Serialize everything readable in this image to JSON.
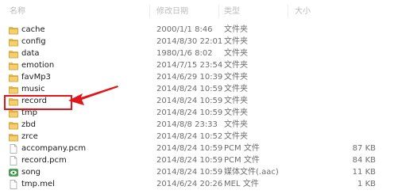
{
  "columns": {
    "name": "名称",
    "date": "修改日期",
    "type": "类型",
    "size": "大小"
  },
  "files": [
    {
      "name": "cache",
      "date": "2000/1/1 8:46",
      "type": "文件夹",
      "size": "",
      "icon": "folder-icon"
    },
    {
      "name": "config",
      "date": "2014/8/30 22:01",
      "type": "文件夹",
      "size": "",
      "icon": "folder-icon"
    },
    {
      "name": "data",
      "date": "1980/1/6 8:02",
      "type": "文件夹",
      "size": "",
      "icon": "folder-icon"
    },
    {
      "name": "emotion",
      "date": "2014/7/15 23:54",
      "type": "文件夹",
      "size": "",
      "icon": "folder-icon"
    },
    {
      "name": "favMp3",
      "date": "2014/6/29 10:39",
      "type": "文件夹",
      "size": "",
      "icon": "folder-icon"
    },
    {
      "name": "music",
      "date": "2014/8/24 10:59",
      "type": "文件夹",
      "size": "",
      "icon": "folder-icon"
    },
    {
      "name": "record",
      "date": "2014/8/24 10:59",
      "type": "文件夹",
      "size": "",
      "icon": "folder-icon"
    },
    {
      "name": "tmp",
      "date": "2014/8/24 10:59",
      "type": "文件夹",
      "size": "",
      "icon": "folder-icon"
    },
    {
      "name": "zbd",
      "date": "2014/8/8 23:33",
      "type": "文件夹",
      "size": "",
      "icon": "folder-icon"
    },
    {
      "name": "zrce",
      "date": "2014/8/24 10:52",
      "type": "文件夹",
      "size": "",
      "icon": "folder-icon"
    },
    {
      "name": "accompany.pcm",
      "date": "2014/8/24 10:59",
      "type": "PCM 文件",
      "size": "87 KB",
      "icon": "file-icon"
    },
    {
      "name": "record.pcm",
      "date": "2014/8/24 10:59",
      "type": "PCM 文件",
      "size": "84 KB",
      "icon": "file-icon"
    },
    {
      "name": "song",
      "date": "2014/8/24 10:59",
      "type": "媒体文件(.aac)",
      "size": "11 KB",
      "icon": "media-file-icon"
    },
    {
      "name": "tmp.mel",
      "date": "2014/6/24 20:26",
      "type": "MEL 文件",
      "size": "1 KB",
      "icon": "file-icon"
    }
  ],
  "colors": {
    "folder": "#e8b84a",
    "annotation": "#e0161b"
  }
}
